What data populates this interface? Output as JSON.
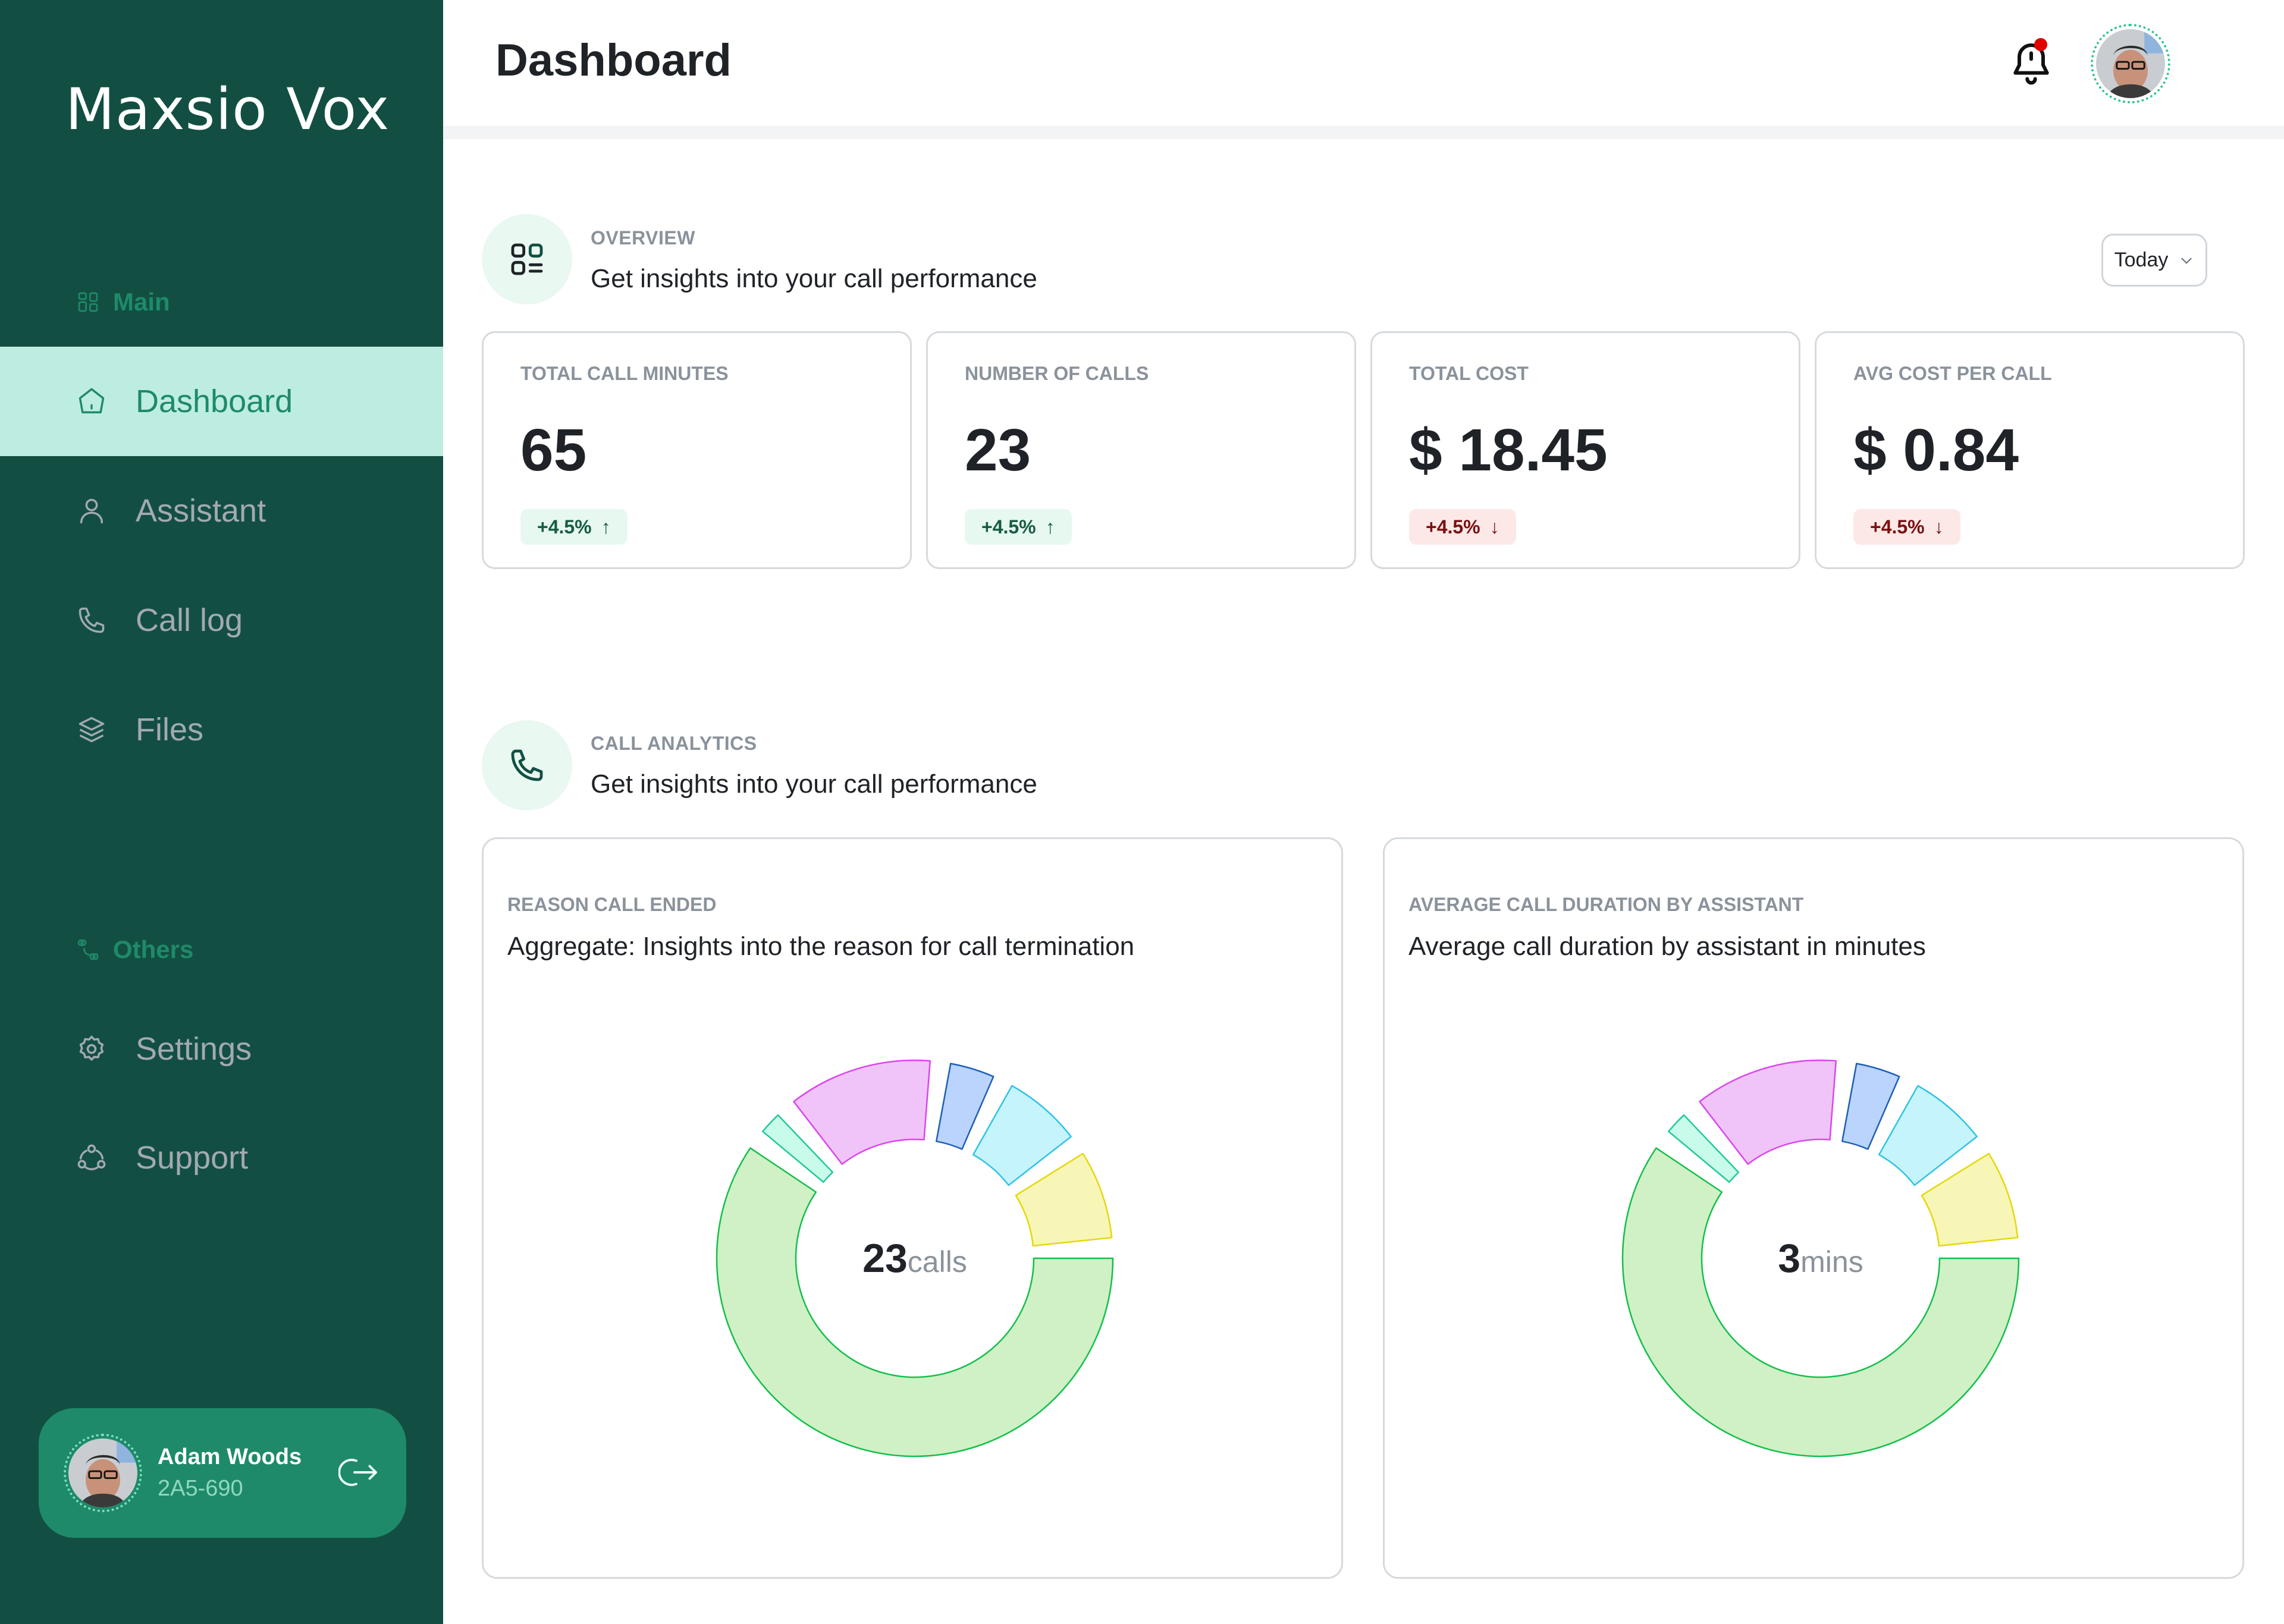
{
  "app": {
    "name": "Maxsio Vox"
  },
  "sidebar": {
    "sections": [
      {
        "label": "Main",
        "icon": "grid-icon"
      },
      {
        "label": "Others",
        "icon": "shapes-icon"
      }
    ],
    "items": [
      {
        "label": "Dashboard",
        "icon": "home-icon",
        "active": true
      },
      {
        "label": "Assistant",
        "icon": "user-icon",
        "active": false
      },
      {
        "label": "Call log",
        "icon": "phone-icon",
        "active": false
      },
      {
        "label": "Files",
        "icon": "layers-icon",
        "active": false
      },
      {
        "label": "Settings",
        "icon": "gear-icon",
        "active": false
      },
      {
        "label": "Support",
        "icon": "support-icon",
        "active": false
      }
    ],
    "user": {
      "name": "Adam Woods",
      "id": "2A5-690"
    }
  },
  "header": {
    "title": "Dashboard",
    "notification_dot": true
  },
  "overview": {
    "kicker": "OVERVIEW",
    "subtitle": "Get insights into your call performance",
    "range": "Today",
    "kpis": [
      {
        "label": "TOTAL CALL MINUTES",
        "value": "65",
        "change": "+4.5%",
        "direction": "up"
      },
      {
        "label": "NUMBER OF CALLS",
        "value": "23",
        "change": "+4.5%",
        "direction": "up"
      },
      {
        "label": "TOTAL COST",
        "value": "$ 18.45",
        "change": "+4.5%",
        "direction": "down"
      },
      {
        "label": "AVG COST PER CALL",
        "value": "$ 0.84",
        "change": "+4.5%",
        "direction": "down"
      }
    ]
  },
  "analytics": {
    "kicker": "CALL ANALYTICS",
    "subtitle": "Get insights into your call performance"
  },
  "colors": {
    "sidebar_bg": "#124f42",
    "accent": "#1e8a6a",
    "active_bg": "#bdede0",
    "up": "#165c43",
    "down": "#7a1010"
  },
  "chart_data": [
    {
      "type": "pie",
      "variant": "donut",
      "kicker": "REASON CALL ENDED",
      "title": "Aggregate: Insights into the reason for call termination",
      "center_value": "23",
      "center_unit": "calls",
      "slices": [
        {
          "share": 66,
          "fill": "#d0f0c6",
          "stroke": "#12c04a"
        },
        {
          "share": 2,
          "fill": "#c8fbea",
          "stroke": "#22c99a"
        },
        {
          "share": 13,
          "fill": "#f0c4f8",
          "stroke": "#d946ef"
        },
        {
          "share": 4,
          "fill": "#bad4fd",
          "stroke": "#1d5fb8"
        },
        {
          "share": 7,
          "fill": "#c6f4fd",
          "stroke": "#2ec4e6"
        },
        {
          "share": 8,
          "fill": "#f7f6b6",
          "stroke": "#e4d80c"
        }
      ]
    },
    {
      "type": "pie",
      "variant": "donut",
      "kicker": "AVERAGE CALL DURATION BY ASSISTANT",
      "title": "Average call duration by assistant in minutes",
      "center_value": "3",
      "center_unit": "mins",
      "slices": [
        {
          "share": 66,
          "fill": "#d0f0c6",
          "stroke": "#12c04a"
        },
        {
          "share": 2,
          "fill": "#c8fbea",
          "stroke": "#22c99a"
        },
        {
          "share": 13,
          "fill": "#f0c4f8",
          "stroke": "#d946ef"
        },
        {
          "share": 4,
          "fill": "#bad4fd",
          "stroke": "#1d5fb8"
        },
        {
          "share": 7,
          "fill": "#c6f4fd",
          "stroke": "#2ec4e6"
        },
        {
          "share": 8,
          "fill": "#f7f6b6",
          "stroke": "#e4d80c"
        }
      ]
    }
  ]
}
